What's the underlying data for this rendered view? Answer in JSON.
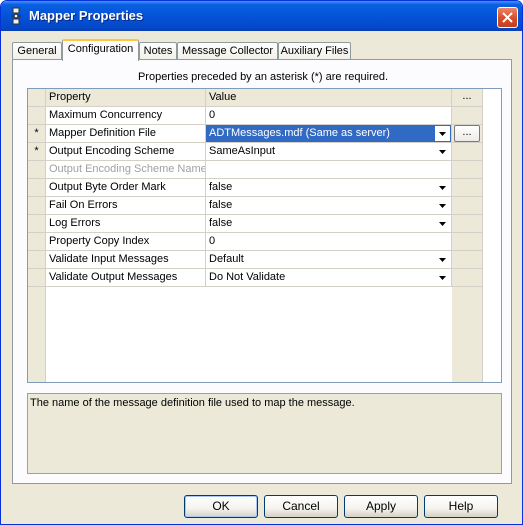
{
  "window": {
    "title": "Mapper Properties"
  },
  "tabs": [
    {
      "label": "General",
      "active": false
    },
    {
      "label": "Configuration",
      "active": true
    },
    {
      "label": "Notes",
      "active": false
    },
    {
      "label": "Message Collector",
      "active": false
    },
    {
      "label": "Auxiliary Files",
      "active": false
    }
  ],
  "note": "Properties preceded by an asterisk (*) are required.",
  "grid": {
    "headers": {
      "property": "Property",
      "value": "Value",
      "extra": "..."
    },
    "rows": [
      {
        "required": "",
        "property": "Maximum Concurrency",
        "value": "0",
        "dropdown": false
      },
      {
        "required": "*",
        "property": "Mapper Definition File",
        "value": "ADTMessages.mdf (Same as server)",
        "dropdown": true,
        "selected": true,
        "ellipsis": "..."
      },
      {
        "required": "*",
        "property": "Output Encoding Scheme",
        "value": "SameAsInput",
        "dropdown": true
      },
      {
        "required": "",
        "property": "Output Encoding Scheme Name",
        "value": "",
        "dropdown": false,
        "disabled": true
      },
      {
        "required": "",
        "property": "Output Byte Order Mark",
        "value": "false",
        "dropdown": true
      },
      {
        "required": "",
        "property": "Fail On Errors",
        "value": "false",
        "dropdown": true
      },
      {
        "required": "",
        "property": "Log Errors",
        "value": "false",
        "dropdown": true
      },
      {
        "required": "",
        "property": "Property Copy Index",
        "value": "0",
        "dropdown": false
      },
      {
        "required": "",
        "property": "Validate Input Messages",
        "value": "Default",
        "dropdown": true
      },
      {
        "required": "",
        "property": "Validate Output Messages",
        "value": "Do Not Validate",
        "dropdown": true
      }
    ]
  },
  "description": "The name of the message definition file used to map the message.",
  "buttons": {
    "ok": "OK",
    "cancel": "Cancel",
    "apply": "Apply",
    "help": "Help"
  },
  "colors": {
    "titlebar": "#0453d9",
    "selection": "#316ac5",
    "tab_highlight": "#ffc83c"
  }
}
